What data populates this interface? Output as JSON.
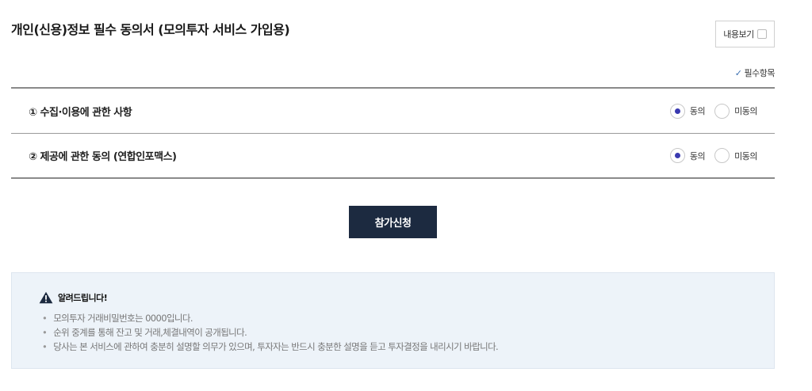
{
  "header": {
    "title": "개인(신용)정보 필수 동의서 (모의투자 서비스 가입용)",
    "view_button_label": "내용보기"
  },
  "required_note": {
    "check_icon": "✓",
    "label": "필수항목"
  },
  "consents": [
    {
      "label": "① 수집·이용에 관한 사항",
      "agree_label": "동의",
      "disagree_label": "미동의",
      "selected": "agree"
    },
    {
      "label": "② 제공에 관한 동의 (연합인포맥스)",
      "agree_label": "동의",
      "disagree_label": "미동의",
      "selected": "agree"
    }
  ],
  "submit_label": "참가신청",
  "notice": {
    "title": "알려드립니다!",
    "items": [
      "모의투자 거래비밀번호는 0000입니다.",
      "순위 중계를 통해 잔고 및 거래,체결내역이 공개됩니다.",
      "당사는 본 서비스에 관하여 충분히 설명할 의무가 있으며, 투자자는 반드시 충분한 설명을 듣고 투자결정을 내리시기 바랍니다."
    ]
  },
  "colors": {
    "button_bg": "#1c2a40",
    "radio_dot": "#3a3ab0",
    "notice_bg": "#edf3f9",
    "check": "#3a6fb0"
  }
}
